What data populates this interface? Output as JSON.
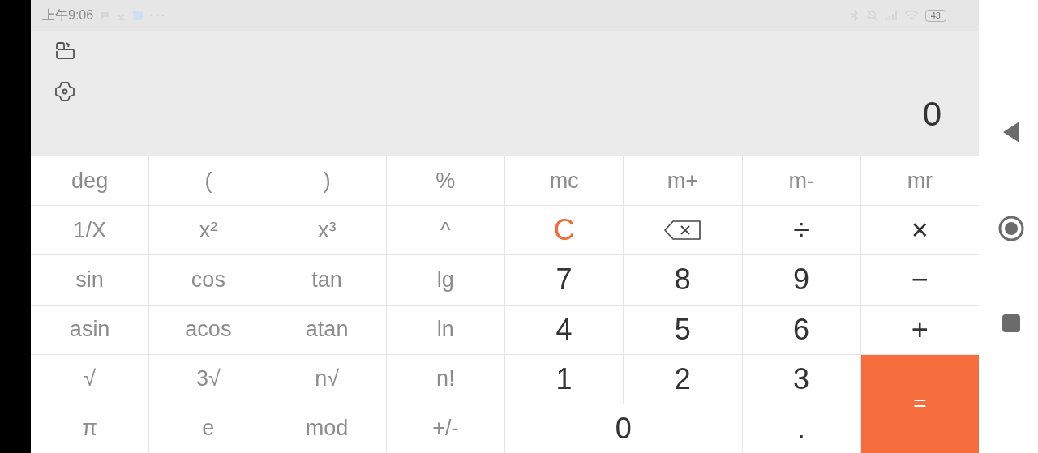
{
  "status_bar": {
    "time": "上午9:06",
    "battery": "43"
  },
  "display": {
    "value": "0"
  },
  "keys": [
    {
      "label": "deg",
      "kind": "sci"
    },
    {
      "label": "(",
      "kind": "sci"
    },
    {
      "label": ")",
      "kind": "sci"
    },
    {
      "label": "%",
      "kind": "sci"
    },
    {
      "label": "mc",
      "kind": "sci"
    },
    {
      "label": "m+",
      "kind": "sci"
    },
    {
      "label": "m-",
      "kind": "sci"
    },
    {
      "label": "mr",
      "kind": "sci"
    },
    {
      "label": "1/X",
      "kind": "sci"
    },
    {
      "label": "x²",
      "kind": "sci"
    },
    {
      "label": "x³",
      "kind": "sci"
    },
    {
      "label": "^",
      "kind": "sci"
    },
    {
      "label": "C",
      "kind": "clear"
    },
    {
      "kind": "backspace"
    },
    {
      "label": "÷",
      "kind": "num"
    },
    {
      "label": "×",
      "kind": "num"
    },
    {
      "label": "sin",
      "kind": "sci"
    },
    {
      "label": "cos",
      "kind": "sci"
    },
    {
      "label": "tan",
      "kind": "sci"
    },
    {
      "label": "lg",
      "kind": "sci"
    },
    {
      "label": "7",
      "kind": "num"
    },
    {
      "label": "8",
      "kind": "num"
    },
    {
      "label": "9",
      "kind": "num"
    },
    {
      "label": "−",
      "kind": "num"
    },
    {
      "label": "asin",
      "kind": "sci"
    },
    {
      "label": "acos",
      "kind": "sci"
    },
    {
      "label": "atan",
      "kind": "sci"
    },
    {
      "label": "ln",
      "kind": "sci"
    },
    {
      "label": "4",
      "kind": "num"
    },
    {
      "label": "5",
      "kind": "num"
    },
    {
      "label": "6",
      "kind": "num"
    },
    {
      "label": "+",
      "kind": "num"
    },
    {
      "label": "√",
      "kind": "sci"
    },
    {
      "label": "3√",
      "kind": "sci"
    },
    {
      "label": "n√",
      "kind": "sci"
    },
    {
      "label": "n!",
      "kind": "sci"
    },
    {
      "label": "1",
      "kind": "num"
    },
    {
      "label": "2",
      "kind": "num"
    },
    {
      "label": "3",
      "kind": "num"
    },
    {
      "label": "=",
      "kind": "equals"
    },
    {
      "label": "π",
      "kind": "sci"
    },
    {
      "label": "e",
      "kind": "sci"
    },
    {
      "label": "mod",
      "kind": "sci"
    },
    {
      "label": "+/-",
      "kind": "sci"
    },
    {
      "label": "0",
      "kind": "zero"
    },
    {
      "label": ".",
      "kind": "num"
    }
  ]
}
